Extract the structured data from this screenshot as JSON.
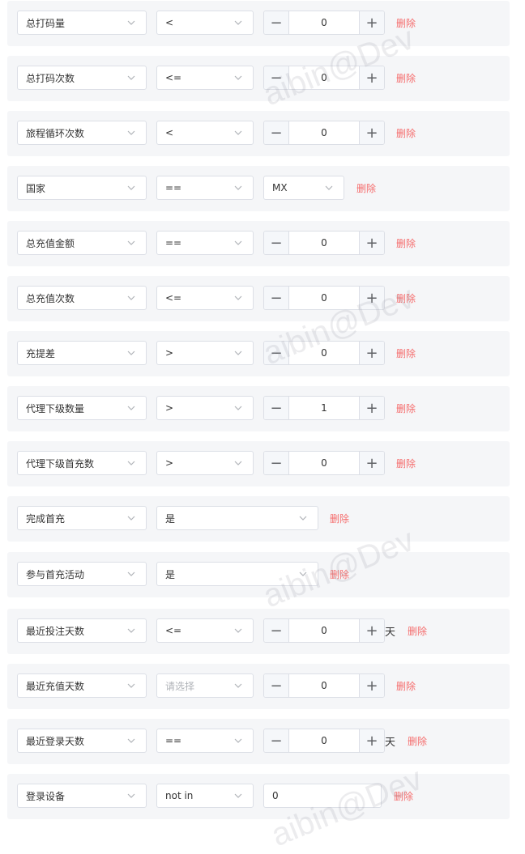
{
  "watermark": "aibin@Dev",
  "delete_label": "删除",
  "rows": [
    {
      "field": "总打码量",
      "op": "<",
      "value": "0",
      "type": "number"
    },
    {
      "field": "总打码次数",
      "op": "<=",
      "value": "0",
      "type": "number"
    },
    {
      "field": "旅程循环次数",
      "op": "<",
      "value": "0",
      "type": "number"
    },
    {
      "field": "国家",
      "op": "==",
      "value": "MX",
      "type": "select"
    },
    {
      "field": "总充值金额",
      "op": "==",
      "value": "0",
      "type": "number"
    },
    {
      "field": "总充值次数",
      "op": "<=",
      "value": "0",
      "type": "number"
    },
    {
      "field": "充提差",
      "op": ">",
      "value": "0",
      "type": "number"
    },
    {
      "field": "代理下级数量",
      "op": ">",
      "value": "1",
      "type": "number"
    },
    {
      "field": "代理下级首充数",
      "op": ">",
      "value": "0",
      "type": "number"
    },
    {
      "field": "完成首充",
      "value": "是",
      "type": "bool"
    },
    {
      "field": "参与首充活动",
      "value": "是",
      "type": "bool"
    },
    {
      "field": "最近投注天数",
      "op": "<=",
      "value": "0",
      "type": "number",
      "unit": "天"
    },
    {
      "field": "最近充值天数",
      "op": "",
      "op_placeholder": "请选择",
      "value": "0",
      "type": "number"
    },
    {
      "field": "最近登录天数",
      "op": "==",
      "value": "0",
      "type": "number",
      "unit": "天"
    },
    {
      "field": "登录设备",
      "op": "not in",
      "value": "0",
      "type": "text"
    }
  ]
}
